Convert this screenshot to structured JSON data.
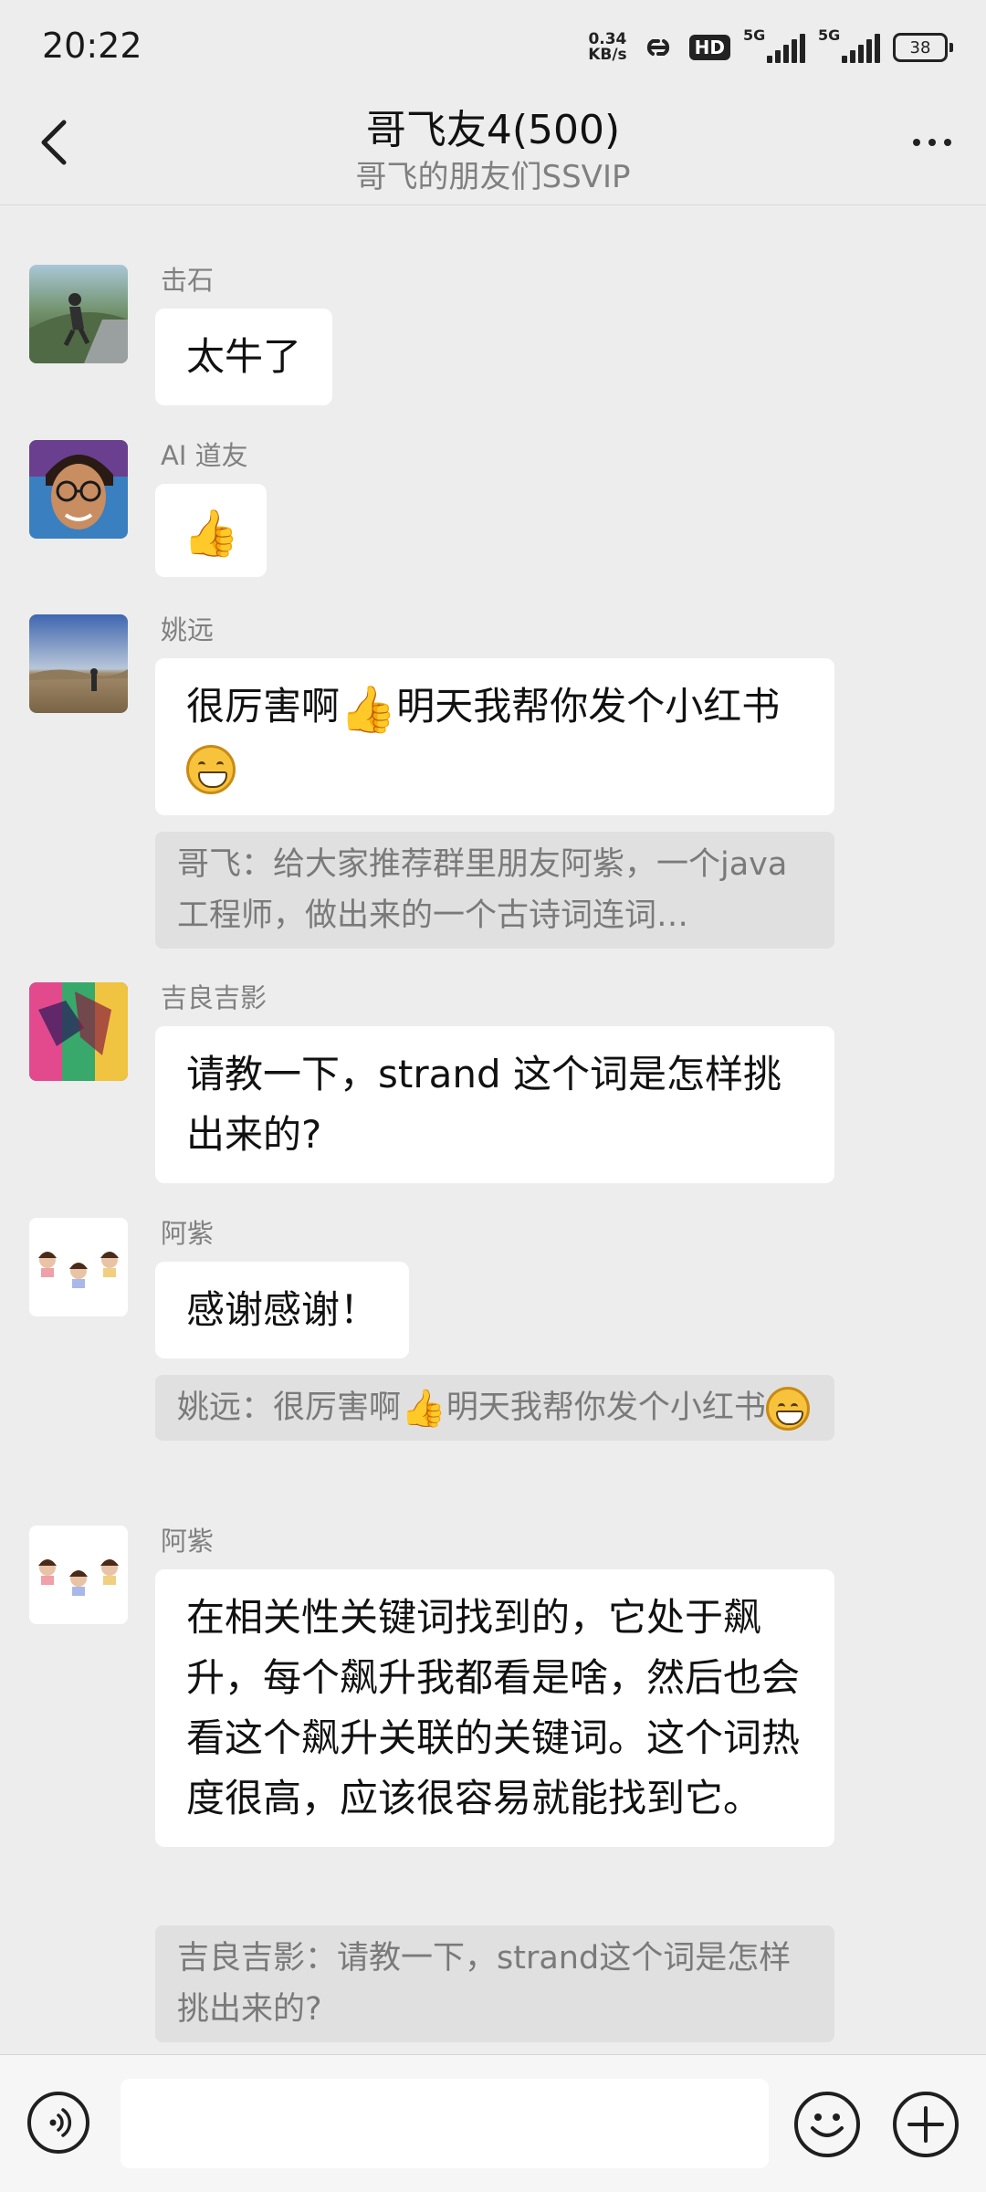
{
  "status_bar": {
    "time": "20:22",
    "net_speed_value": "0.34",
    "net_speed_unit": "KB/s",
    "hd_badge": "HD",
    "sim1": "5G",
    "sim2": "5G",
    "battery": "38"
  },
  "header": {
    "title": "哥飞友4(500)",
    "subtitle": "哥飞的朋友们SSVIP"
  },
  "messages": [
    {
      "sender": "击石",
      "text": "太牛了"
    },
    {
      "sender": "AI 道友",
      "emoji": "👍"
    },
    {
      "sender": "姚远",
      "text_a": "很厉害啊",
      "text_b": "明天我帮你发个小红书",
      "quote": "哥飞：给大家推荐群里朋友阿紫，一个java工程师，做出来的一个古诗词连词…"
    },
    {
      "sender": "吉良吉影",
      "text": "请教一下，strand 这个词是怎样挑出来的?"
    },
    {
      "sender": "阿紫",
      "text": "感谢感谢！",
      "quote_a": "姚远：很厉害啊",
      "quote_b": "明天我帮你发个小红书"
    },
    {
      "sender": "阿紫",
      "text": "在相关性关键词找到的，它处于飙升，每个飙升我都看是啥，然后也会看这个飙升关联的关键词。这个词热度很高，应该很容易就能找到它。",
      "quote": "吉良吉影：请教一下，strand这个词是怎样挑出来的?"
    }
  ],
  "icons": {
    "back": "chevron-left-icon",
    "more": "more-dots-icon",
    "voice": "voice-icon",
    "emoji": "emoji-icon",
    "plus": "plus-icon"
  },
  "input": {
    "value": "",
    "placeholder": ""
  }
}
